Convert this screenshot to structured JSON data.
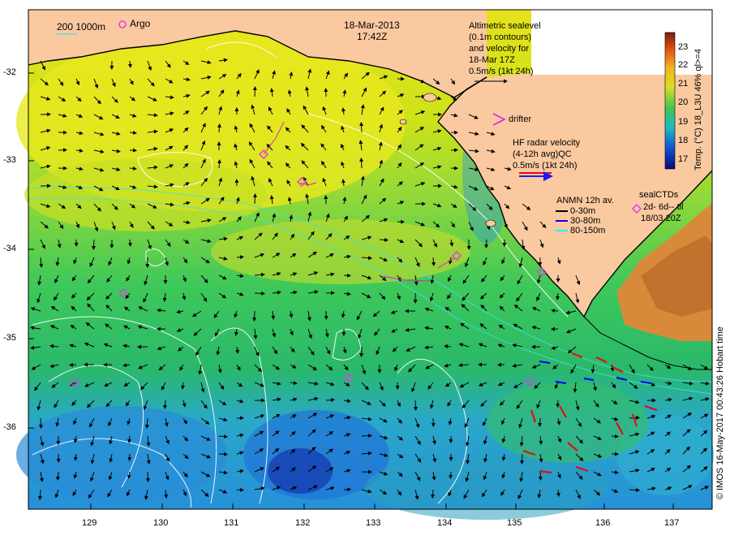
{
  "header": {
    "date": "18-Mar-2013",
    "time": "17:42Z"
  },
  "legend": {
    "depth_contours": "200  1000m",
    "argo": "Argo",
    "altimetry": [
      "Altimetric sealevel",
      "(0.1m contours)",
      "and velocity for",
      "18-Mar 17Z",
      "0.5m/s (1kt 24h)"
    ],
    "drifter": "drifter",
    "hf_radar": [
      "HF radar velocity",
      "(4-12h avg)QC",
      "0.5m/s (1kt 24h)"
    ],
    "anmn": {
      "title": "ANMN 12h av.",
      "items": [
        {
          "label": "0-30m",
          "color": "#000000"
        },
        {
          "label": "30-80m",
          "color": "#0000ee"
        },
        {
          "label": "80-150m",
          "color": "#00ffff"
        }
      ]
    },
    "sealctds": [
      "sealCTDs",
      "2d- 6d-- til",
      "18/03 20Z"
    ]
  },
  "axes": {
    "y_ticks": [
      "-32",
      "-33",
      "-34",
      "-35",
      "-36"
    ],
    "x_ticks": [
      "129",
      "130",
      "131",
      "132",
      "133",
      "134",
      "135",
      "136",
      "137"
    ]
  },
  "colorbar": {
    "label": "Temp. (°C) 18_L3U 46% ql>=4",
    "ticks": [
      "23",
      "22",
      "21",
      "20",
      "19",
      "18",
      "17"
    ],
    "range": [
      16.5,
      23.8
    ]
  },
  "credit": "© IMOS 16-May-2017 00:43:26 Hobart time",
  "colors": {
    "land": "#fac9a0",
    "argo": "#e040e0",
    "hf_radar": "#ff0000"
  }
}
